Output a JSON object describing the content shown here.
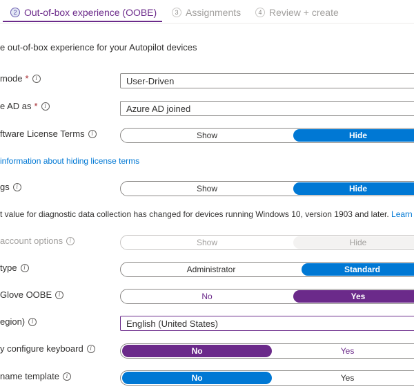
{
  "wizard": {
    "steps": [
      {
        "num": "2",
        "label": "Out-of-box experience (OOBE)"
      },
      {
        "num": "3",
        "label": "Assignments"
      },
      {
        "num": "4",
        "label": "Review + create"
      }
    ]
  },
  "intro": "e out-of-box experience for your Autopilot devices",
  "rows": {
    "mode": {
      "label": "mode",
      "required": "*",
      "value": "User-Driven"
    },
    "join": {
      "label": "e AD as",
      "required": "*",
      "value": "Azure AD joined"
    },
    "license": {
      "label": "ftware License Terms",
      "left": "Show",
      "right": "Hide"
    },
    "license_link": "information about hiding license terms",
    "privacy": {
      "label": "gs",
      "left": "Show",
      "right": "Hide"
    },
    "notice": {
      "text": "t value for diagnostic data collection has changed for devices running Windows 10, version 1903 and later.",
      "link": "Learn mor"
    },
    "account": {
      "label": " account options",
      "left": "Show",
      "right": "Hide"
    },
    "usertype": {
      "label": " type",
      "left": "Administrator",
      "right": "Standard"
    },
    "glove": {
      "label": "Glove OOBE",
      "left": "No",
      "right": "Yes"
    },
    "region": {
      "label": "egion)",
      "value": "English (United States)"
    },
    "keyboard": {
      "label": "y configure keyboard",
      "left": "No",
      "right": "Yes"
    },
    "nametemplate": {
      "label": " name template",
      "left": "No",
      "right": "Yes"
    }
  },
  "colors": {
    "accent": "#0078d4",
    "purple": "#6b2a8a"
  }
}
